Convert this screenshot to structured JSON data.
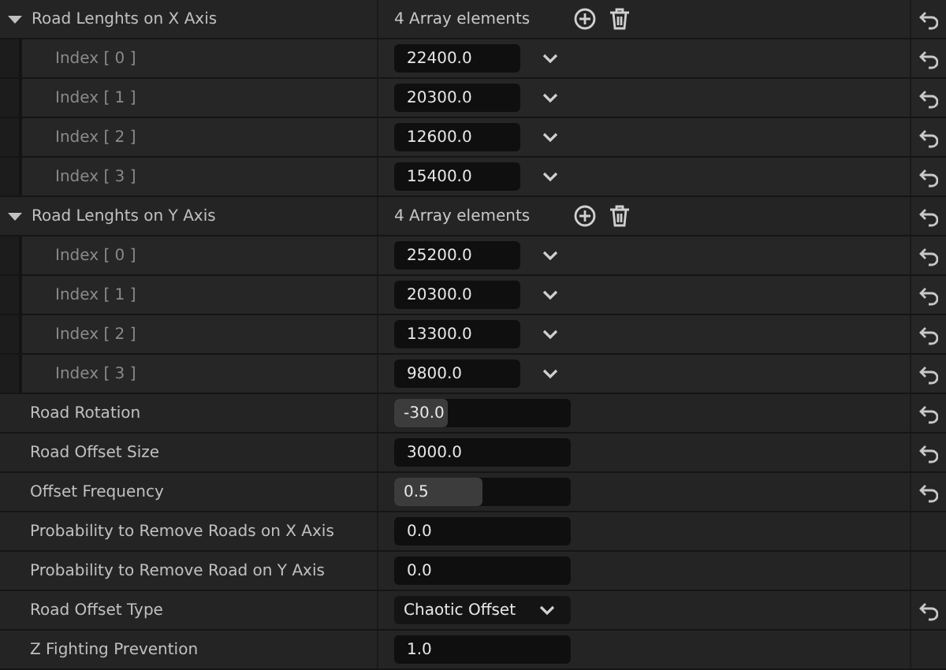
{
  "properties": [
    {
      "kind": "array",
      "label": "Road Lenghts on X Axis",
      "expanded": true,
      "summary": "4 Array elements",
      "reset": true,
      "children": [
        {
          "label": "Index [ 0 ]",
          "value": "22400.0",
          "reset": true
        },
        {
          "label": "Index [ 1 ]",
          "value": "20300.0",
          "reset": true
        },
        {
          "label": "Index [ 2 ]",
          "value": "12600.0",
          "reset": true
        },
        {
          "label": "Index [ 3 ]",
          "value": "15400.0",
          "reset": true
        }
      ]
    },
    {
      "kind": "array",
      "label": "Road Lenghts on Y Axis",
      "expanded": true,
      "summary": "4 Array elements",
      "reset": true,
      "children": [
        {
          "label": "Index [ 0 ]",
          "value": "25200.0",
          "reset": true
        },
        {
          "label": "Index [ 1 ]",
          "value": "20300.0",
          "reset": true
        },
        {
          "label": "Index [ 2 ]",
          "value": "13300.0",
          "reset": true
        },
        {
          "label": "Index [ 3 ]",
          "value": "9800.0",
          "reset": true
        }
      ]
    },
    {
      "kind": "slider",
      "label": "Road Rotation",
      "value": "-30.0",
      "level": 0.3,
      "reset": true
    },
    {
      "kind": "number",
      "label": "Road Offset Size",
      "value": "3000.0",
      "reset": true
    },
    {
      "kind": "slider",
      "label": "Offset Frequency",
      "value": "0.5",
      "level": 0.5,
      "reset": true
    },
    {
      "kind": "number",
      "label": "Probability to Remove Roads on X Axis",
      "value": "0.0",
      "reset": false
    },
    {
      "kind": "number",
      "label": "Probability to Remove Road on Y Axis",
      "value": "0.0",
      "reset": false
    },
    {
      "kind": "dropdown",
      "label": "Road Offset Type",
      "value": "Chaotic Offset",
      "reset": true
    },
    {
      "kind": "number",
      "label": "Z Fighting Prevention",
      "value": "1.0",
      "reset": false
    }
  ]
}
